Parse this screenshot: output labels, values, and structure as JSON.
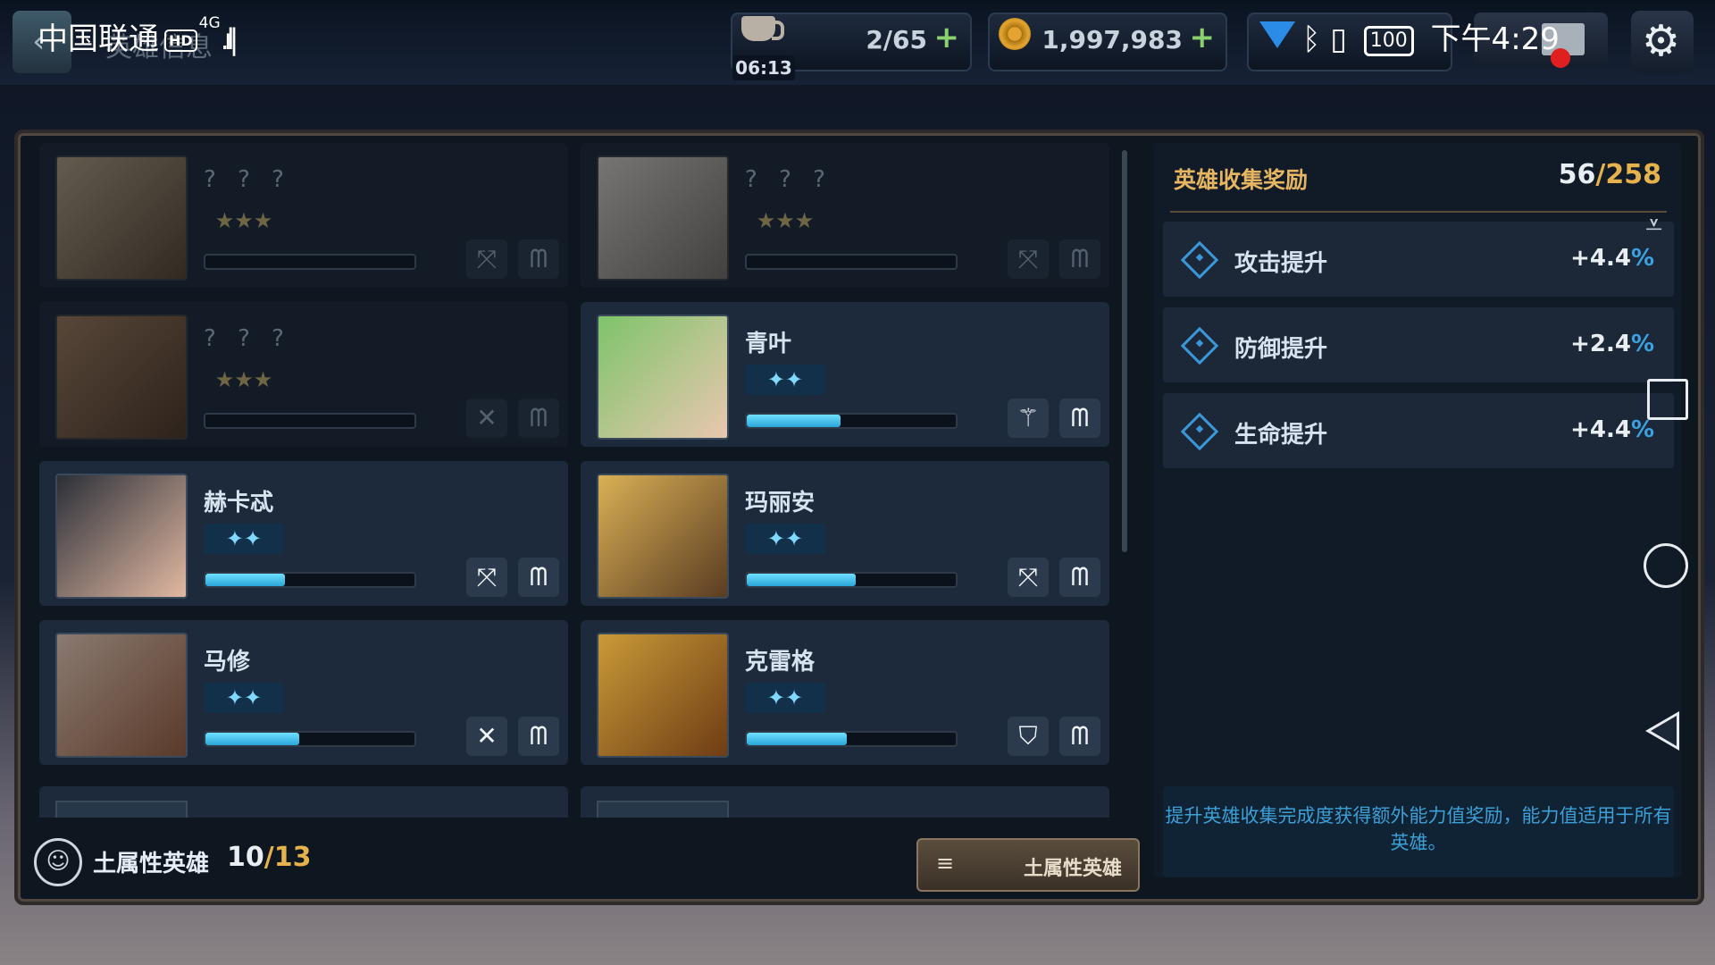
{
  "status_bar": {
    "carrier": "中国联通",
    "hd": "HD",
    "network": "4G",
    "battery": "100",
    "time": "下午4:29"
  },
  "header": {
    "back_icon": "chevron-left-icon",
    "title": "英雄信息"
  },
  "resources": {
    "stamina": {
      "icon": "coffee-cup-icon",
      "value": "2/65",
      "plus": "+",
      "timer": "06:13"
    },
    "gold": {
      "icon": "gold-coin-icon",
      "value": "1,997,983",
      "plus": "+"
    },
    "gems": {
      "icon": "blue-gem-icon"
    }
  },
  "top_right": {
    "mail_icon": "mail-icon",
    "settings_icon": "gear-icon"
  },
  "heroes": [
    {
      "name": "? ? ?",
      "stars": "★★★",
      "locked": true,
      "progress": 0,
      "role_icon": "crossed-bow-icon",
      "element_icon": "earth-mountain-icon"
    },
    {
      "name": "? ? ?",
      "stars": "★★★",
      "locked": true,
      "progress": 0,
      "role_icon": "crossed-bow-icon",
      "element_icon": "earth-mountain-icon"
    },
    {
      "name": "? ? ?",
      "stars": "★★★",
      "locked": true,
      "progress": 0,
      "role_icon": "crossed-swords-icon",
      "element_icon": "earth-mountain-icon"
    },
    {
      "name": "青叶",
      "stars": "✦✦",
      "locked": false,
      "progress": 0.45,
      "role_icon": "winged-staff-icon",
      "element_icon": "earth-mountain-icon"
    },
    {
      "name": "赫卡忒",
      "stars": "✦✦",
      "locked": false,
      "progress": 0.38,
      "role_icon": "crossed-bow-icon",
      "element_icon": "earth-mountain-icon"
    },
    {
      "name": "玛丽安",
      "stars": "✦✦",
      "locked": false,
      "progress": 0.52,
      "role_icon": "crossed-bow-icon",
      "element_icon": "earth-mountain-icon"
    },
    {
      "name": "马修",
      "stars": "✦✦",
      "locked": false,
      "progress": 0.45,
      "role_icon": "crossed-swords-icon",
      "element_icon": "earth-mountain-icon"
    },
    {
      "name": "克雷格",
      "stars": "✦✦",
      "locked": false,
      "progress": 0.48,
      "role_icon": "shield-icon",
      "element_icon": "earth-mountain-icon"
    }
  ],
  "footer": {
    "element_label": "土属性英雄",
    "owned": "10",
    "total": "13",
    "filter_label": "土属性英雄",
    "filter_icon": "menu-icon"
  },
  "collection": {
    "title": "英雄收集奖励",
    "current": "56",
    "total": "258",
    "bonuses": [
      {
        "label": "攻击提升",
        "value": "+4.4",
        "unit": "%"
      },
      {
        "label": "防御提升",
        "value": "+2.4",
        "unit": "%"
      },
      {
        "label": "生命提升",
        "value": "+4.4",
        "unit": "%"
      }
    ],
    "note": "提升英雄收集完成度获得额外能力值奖励，能力值适用于所有英雄。"
  },
  "colors": {
    "accent_gold": "#e5b24c",
    "progress_blue": "#2ba6d8",
    "bonus_blue": "#3aa2e0"
  }
}
